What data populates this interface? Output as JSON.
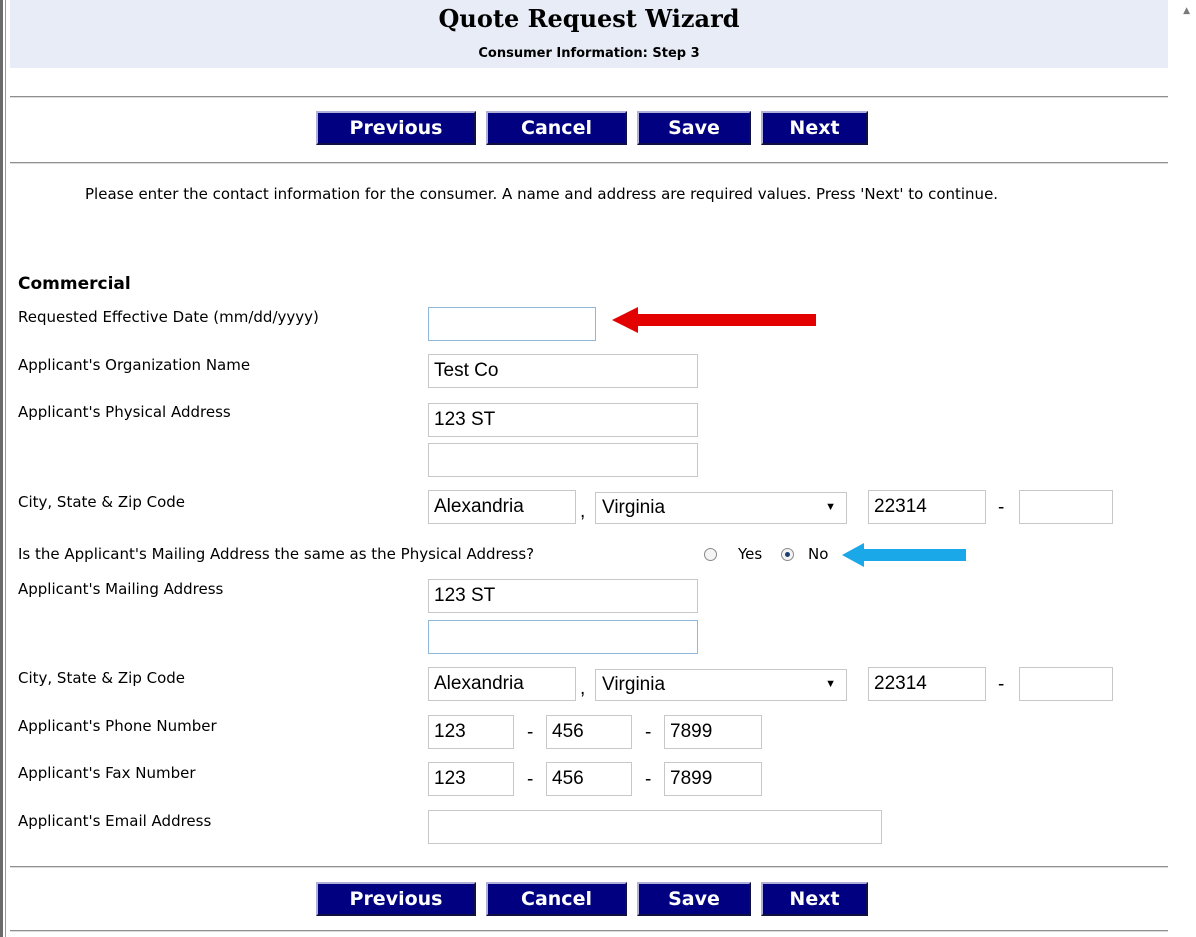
{
  "header": {
    "title": "Quote Request Wizard",
    "subtitle": "Consumer Information: Step 3"
  },
  "buttons": {
    "previous": "Previous",
    "cancel": "Cancel",
    "save": "Save",
    "next": "Next"
  },
  "instructions": "Please enter the contact information for the consumer. A name and address are required values. Press 'Next' to continue.",
  "section_title": "Commercial",
  "fields": {
    "effective_date": {
      "label": "Requested Effective Date (mm/dd/yyyy)",
      "value": ""
    },
    "org_name": {
      "label": "Applicant's Organization Name",
      "value": "Test Co"
    },
    "physical_address": {
      "label": "Applicant's Physical Address",
      "line1": "123 ST",
      "line2": ""
    },
    "physical_city": {
      "label": "City, State & Zip Code",
      "city": "Alexandria",
      "state": "Virginia",
      "zip": "22314",
      "zip_ext": ""
    },
    "same_address": {
      "question": "Is the Applicant's Mailing Address the same as the Physical Address?",
      "yes_label": "Yes",
      "no_label": "No",
      "selected": "No"
    },
    "mailing_address": {
      "label": "Applicant's Mailing Address",
      "line1": "123 ST",
      "line2": ""
    },
    "mailing_city": {
      "label": "City, State & Zip Code",
      "city": "Alexandria",
      "state": "Virginia",
      "zip": "22314",
      "zip_ext": ""
    },
    "phone": {
      "label": "Applicant's Phone Number",
      "area": "123",
      "prefix": "456",
      "line": "7899"
    },
    "fax": {
      "label": "Applicant's Fax Number",
      "area": "123",
      "prefix": "456",
      "line": "7899"
    },
    "email": {
      "label": "Applicant's Email Address",
      "value": ""
    }
  },
  "separators": {
    "comma": ",",
    "dash": "-"
  },
  "colors": {
    "button_bg": "#000080",
    "header_bg": "#e8ecf6",
    "annotation_red": "#e30000",
    "annotation_blue": "#1aa8e8"
  }
}
